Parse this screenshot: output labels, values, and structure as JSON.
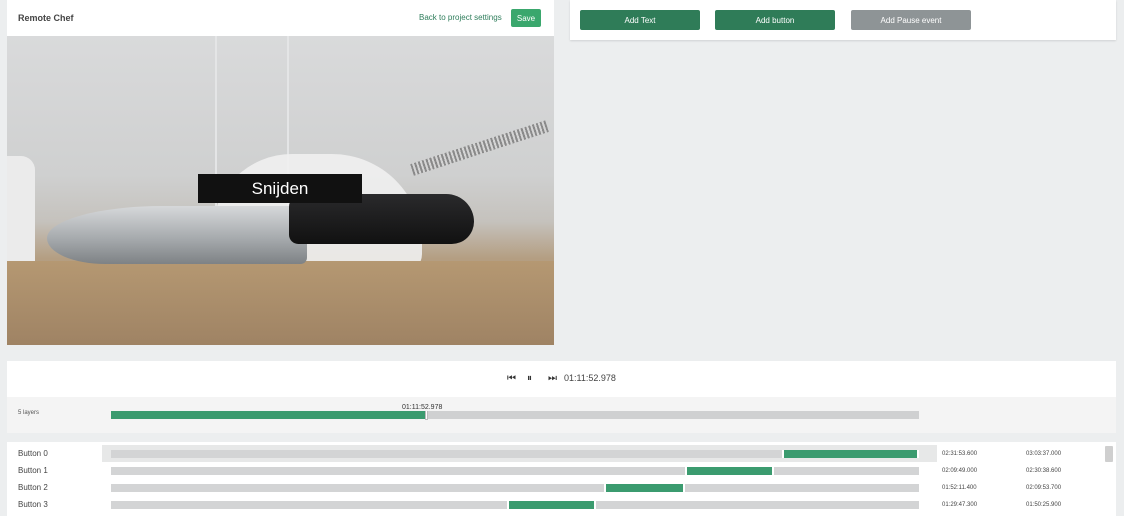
{
  "editor": {
    "project_title": "Remote Chef",
    "back_link": "Back to project settings",
    "save_label": "Save",
    "caption_text": "Snijden"
  },
  "actions": {
    "add_text": "Add Text",
    "add_button": "Add button",
    "add_pause": "Add Pause event"
  },
  "playback": {
    "prev_icon": "skip-back-icon",
    "pause_icon": "pause-icon",
    "next_icon": "skip-forward-icon",
    "current_time": "01:11:52.978",
    "prev_glyph": "⏮",
    "pause_glyph": "⏸",
    "next_glyph": "⏭"
  },
  "timeline": {
    "layers_label": "5 layers",
    "playhead_time": "01:11:52.978",
    "playhead_fraction": 0.39
  },
  "rows": [
    {
      "label": "Button 0",
      "start": "02:31:53.600",
      "end": "03:03:37.000",
      "seg_from": 0.83,
      "seg_to": 1.0
    },
    {
      "label": "Button 1",
      "start": "02:09:49.000",
      "end": "02:30:38.600",
      "seg_from": 0.71,
      "seg_to": 0.82
    },
    {
      "label": "Button 2",
      "start": "01:52:11.400",
      "end": "02:09:53.700",
      "seg_from": 0.61,
      "seg_to": 0.71
    },
    {
      "label": "Button 3",
      "start": "01:29:47.300",
      "end": "01:50:25.900",
      "seg_from": 0.49,
      "seg_to": 0.6
    }
  ],
  "colors": {
    "accent": "#2f7c58",
    "track_fill": "#3b9b6f",
    "save": "#3aa76d",
    "disabled": "#8e9496"
  }
}
